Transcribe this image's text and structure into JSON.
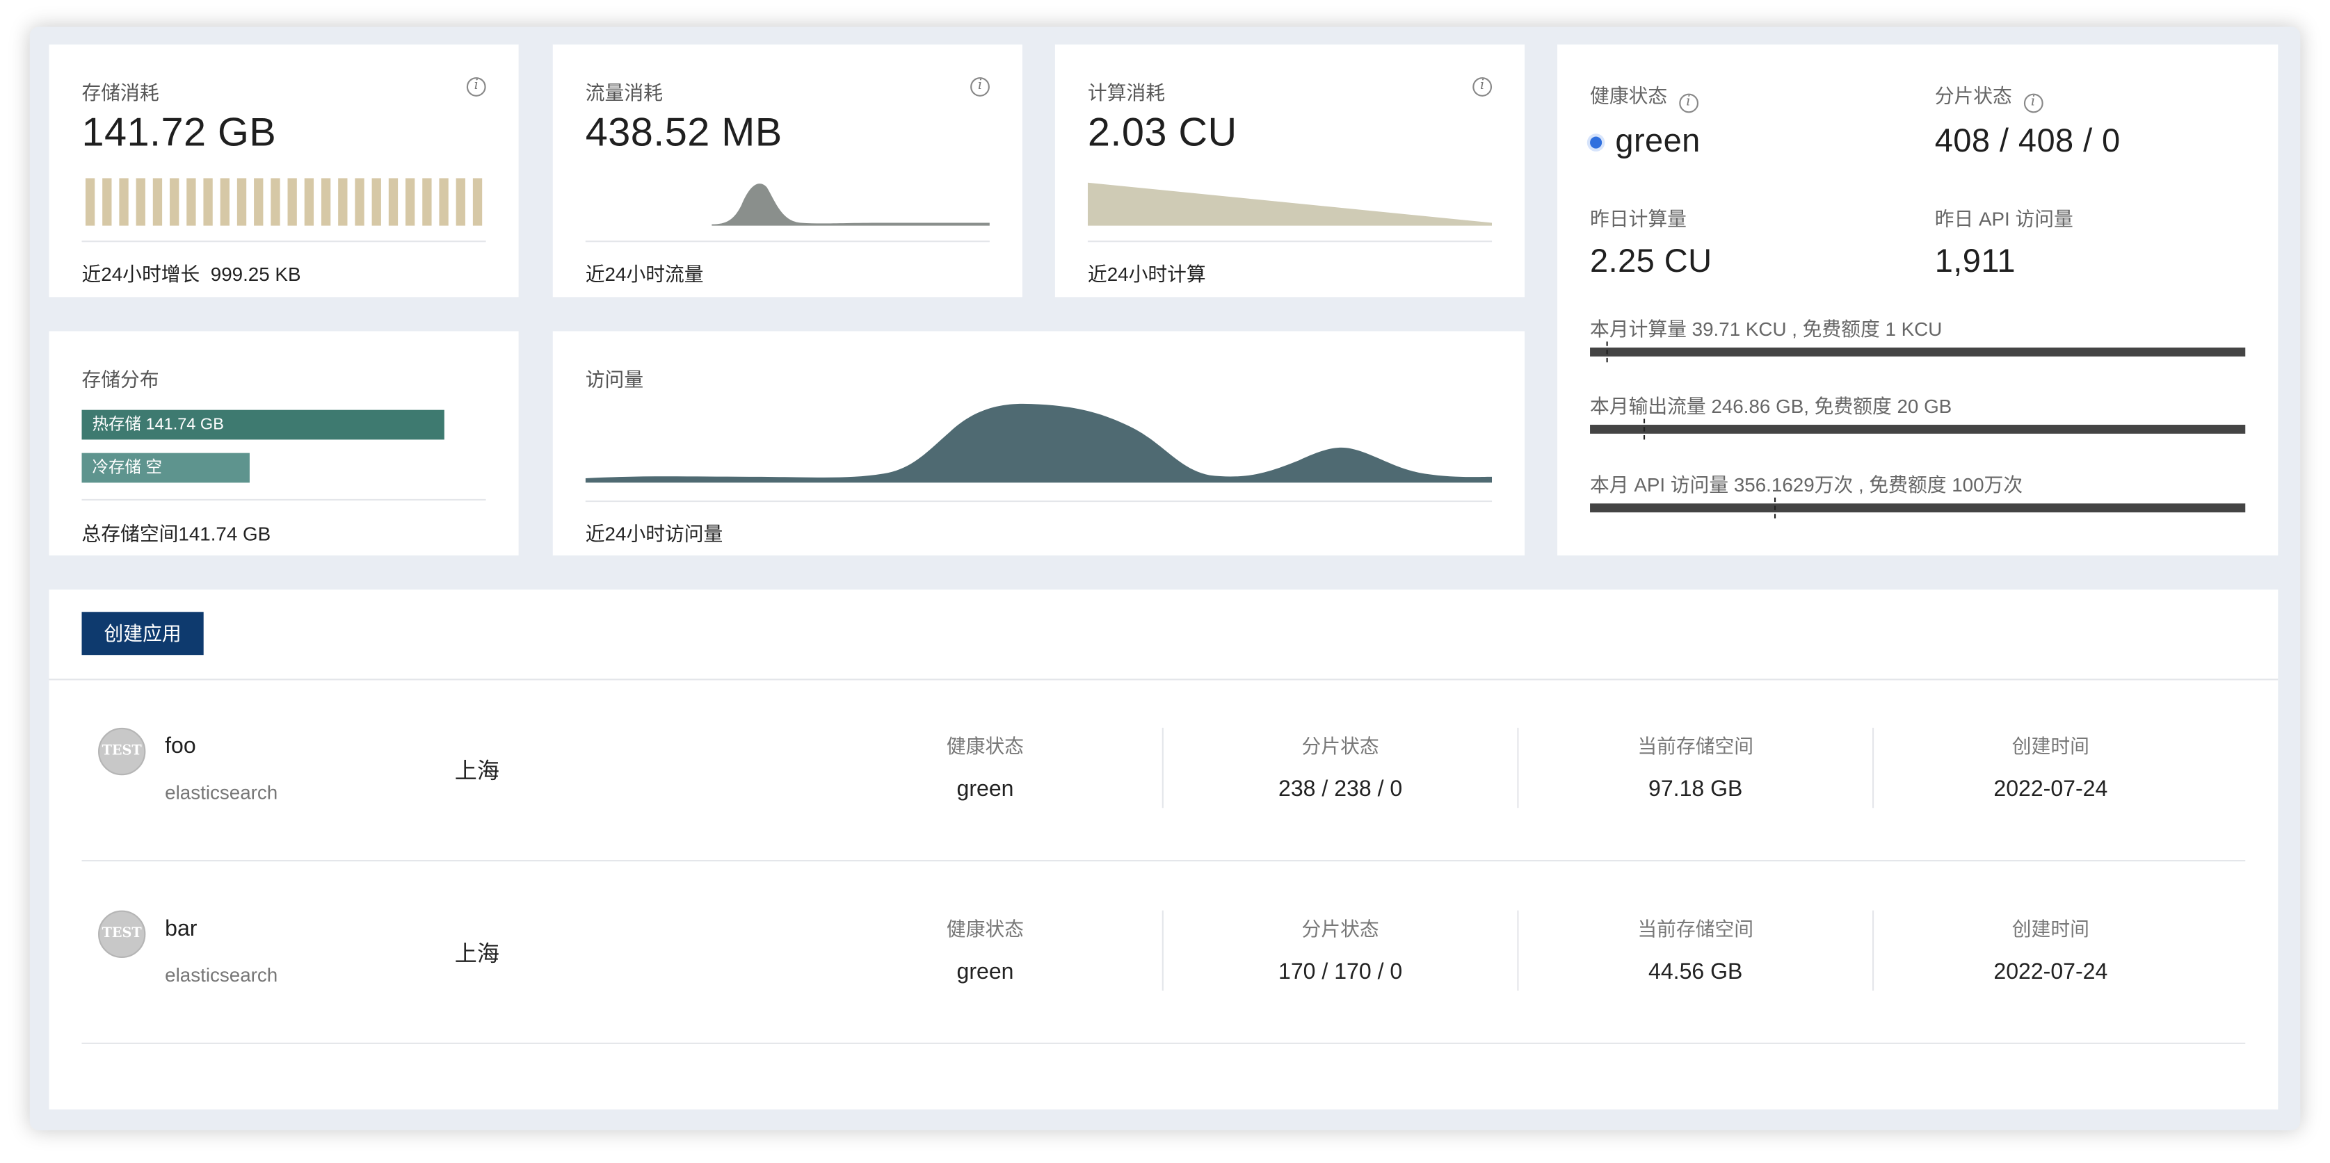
{
  "cards": {
    "storage": {
      "title": "存储消耗",
      "value": "141.72 GB",
      "footer_label": "近24小时增长",
      "footer_value": "999.25 KB",
      "bar_color": "#d6c8a6",
      "bar_count": 24
    },
    "traffic": {
      "title": "流量消耗",
      "value": "438.52 MB",
      "footer": "近24小时流量",
      "chart_color": "#8a8f8c"
    },
    "compute": {
      "title": "计算消耗",
      "value": "2.03 CU",
      "footer": "近24小时计算",
      "chart_color": "#cfcbb5"
    },
    "distribution": {
      "title": "存储分布",
      "hot_label": "热存储 141.74 GB",
      "cold_label": "冷存储 空",
      "hot_color": "#3e7a70",
      "cold_color": "#5e948e",
      "footer": "总存储空间141.74 GB"
    },
    "visits": {
      "title": "访问量",
      "footer": "近24小时访问量",
      "chart_color": "#4f6a72"
    },
    "status": {
      "health_label": "健康状态",
      "health_value": "green",
      "health_dot_color": "#2f6fde",
      "shard_label": "分片状态",
      "shard_value": "408 / 408 / 0",
      "yesterday_compute_label": "昨日计算量",
      "yesterday_compute_value": "2.25 CU",
      "yesterday_api_label": "昨日 API 访问量",
      "yesterday_api_value": "1,911",
      "monthly_compute": "本月计算量 39.71 KCU , 免费额度 1 KCU",
      "monthly_traffic": "本月输出流量 246.86 GB, 免费额度 20 GB",
      "monthly_api": "本月 API 访问量 356.1629万次 , 免费额度 100万次"
    }
  },
  "apps": {
    "create_button": "创建应用",
    "avatar_text": "TEST",
    "columns": {
      "health": "健康状态",
      "shards": "分片状态",
      "storage": "当前存储空间",
      "created": "创建时间"
    },
    "rows": [
      {
        "name": "foo",
        "type": "elasticsearch",
        "region": "上海",
        "health": "green",
        "shards": "238 / 238 / 0",
        "storage": "97.18 GB",
        "created": "2022-07-24"
      },
      {
        "name": "bar",
        "type": "elasticsearch",
        "region": "上海",
        "health": "green",
        "shards": "170 / 170 / 0",
        "storage": "44.56 GB",
        "created": "2022-07-24"
      }
    ]
  }
}
